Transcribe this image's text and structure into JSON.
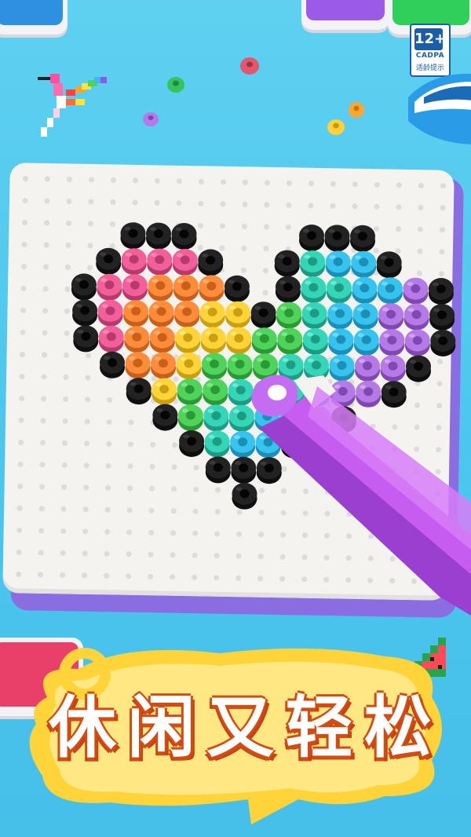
{
  "rating": {
    "age": "12+",
    "org": "CADPA",
    "caption": "适龄提示"
  },
  "slogan": "休闲又轻松",
  "artwork": "rainbow-heart",
  "colors": {
    "background": "#4cc6ee",
    "board": "#f5f3f0",
    "board_base": "#8a6de0",
    "tweezers": "#b34ee0",
    "outline_bead": "#222222",
    "banner": "#ffd43a",
    "slogan_outline": "#d24c16"
  }
}
